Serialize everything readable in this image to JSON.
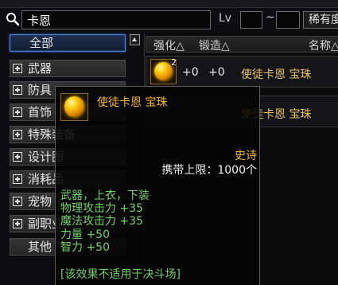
{
  "colors": {
    "background": "#0d0d0f",
    "epic": "#f6b43a",
    "effect_green": "#74d06c",
    "selected_border": "#4a7bd0",
    "item_name": "#e8c36a"
  },
  "icons": {
    "search": "search-icon",
    "expand": "expand-icon",
    "scroll_up": "triangle-up-icon",
    "item": "orb-icon"
  },
  "search": {
    "query": "卡恩",
    "level_label": "Lv",
    "level_min": "",
    "level_max": "",
    "range_separator": "~",
    "rarity_label": "稀有度"
  },
  "categories": [
    {
      "label": "全部",
      "selected": true,
      "expandable": false
    },
    {
      "label": "武器",
      "expandable": true
    },
    {
      "label": "防具",
      "expandable": true
    },
    {
      "label": "首饰",
      "expandable": true
    },
    {
      "label": "特殊装备",
      "expandable": true
    },
    {
      "label": "设计图",
      "expandable": true
    },
    {
      "label": "消耗品",
      "expandable": true
    },
    {
      "label": "宠物",
      "expandable": true
    },
    {
      "label": "副职业",
      "expandable": true
    },
    {
      "label": "其他",
      "expandable": false
    }
  ],
  "columns": {
    "enhance": "强化△",
    "forge": "锻造△",
    "name": "名称△"
  },
  "rows": [
    {
      "count": "2",
      "enhance": "+0",
      "forge": "+0",
      "name": "使徒卡恩 宝珠"
    },
    {
      "name": "使徒卡恩 宝珠"
    }
  ],
  "tooltip": {
    "title": "使徒卡恩 宝珠",
    "rarity": "史诗",
    "carry_limit": "携带上限：1000个",
    "slots": "武器，上衣，下装",
    "stats": [
      "物理攻击力 +35",
      "魔法攻击力 +35",
      "力量 +50",
      "智力 +50"
    ],
    "note": "[该效果不适用于决斗场]"
  }
}
